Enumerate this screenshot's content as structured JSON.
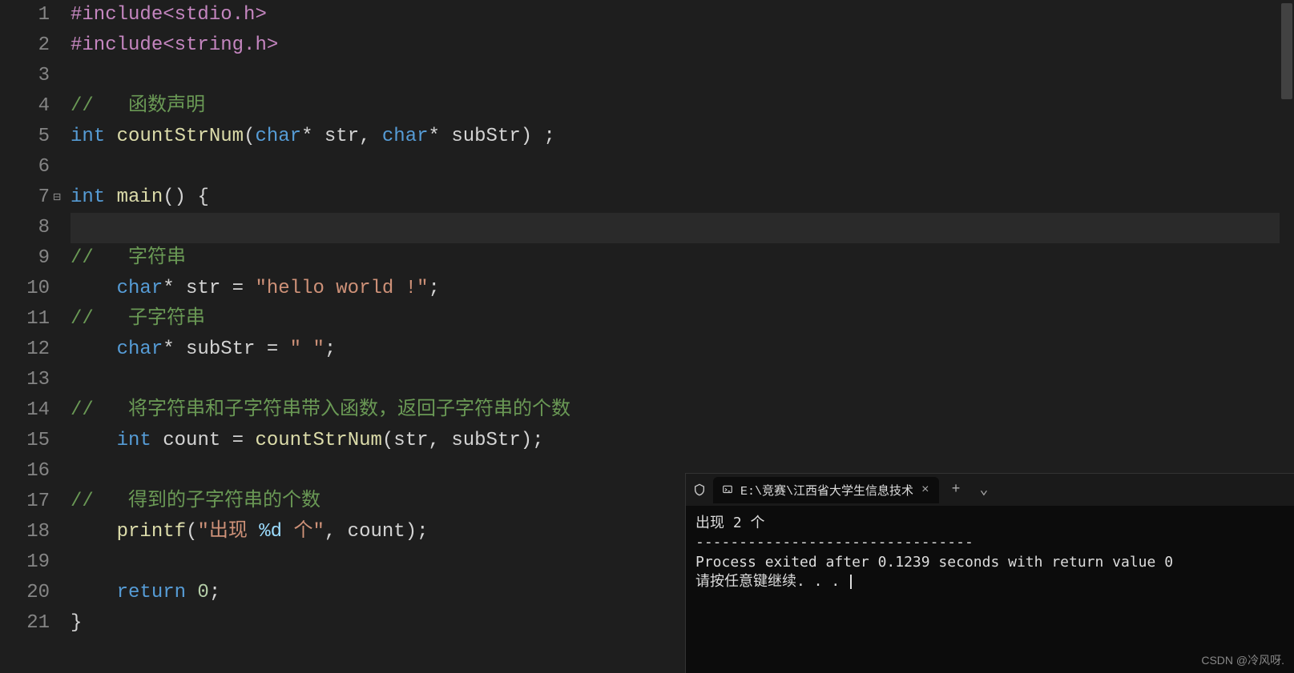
{
  "gutter": {
    "lines": [
      "1",
      "2",
      "3",
      "4",
      "5",
      "6",
      "7",
      "8",
      "9",
      "10",
      "11",
      "12",
      "13",
      "14",
      "15",
      "16",
      "17",
      "18",
      "19",
      "20",
      "21"
    ],
    "fold_line": 7
  },
  "code": {
    "l1_pre": "#include",
    "l1_path": "<stdio.h>",
    "l2_pre": "#include",
    "l2_path": "<string.h>",
    "l4_comment": "//   函数声明",
    "l5_type": "int",
    "l5_func": "countStrNum",
    "l5_p1_type": "char",
    "l5_p1_star": "*",
    "l5_p1_name": " str",
    "l5_comma": ", ",
    "l5_p2_type": "char",
    "l5_p2_star": "*",
    "l5_p2_name": " subStr",
    "l5_end": ") ;",
    "l7_type": "int",
    "l7_func": "main",
    "l7_rest": "() {",
    "l9_comment": "//   字符串",
    "l10_type": "char",
    "l10_star": "*",
    "l10_name": " str ",
    "l10_eq": "= ",
    "l10_str": "\"hello world !\"",
    "l10_semi": ";",
    "l11_comment": "//   子字符串",
    "l12_type": "char",
    "l12_star": "*",
    "l12_name": " subStr ",
    "l12_eq": "= ",
    "l12_str": "\" \"",
    "l12_semi": ";",
    "l14_comment": "//   将字符串和子字符串带入函数，返回子字符串的个数",
    "l15_type": "int",
    "l15_name": " count ",
    "l15_eq": "= ",
    "l15_func": "countStrNum",
    "l15_args": "(str, subStr);",
    "l17_comment": "//   得到的子字符串的个数",
    "l18_func": "printf",
    "l18_open": "(",
    "l18_str1": "\"出现 ",
    "l18_fmt": "%d",
    "l18_str2": " 个\"",
    "l18_rest": ", count);",
    "l20_kw": "return",
    "l20_num": " 0",
    "l20_semi": ";",
    "l21_brace": "}"
  },
  "terminal": {
    "tab_title": "E:\\竞赛\\江西省大学生信息技术",
    "out_line1": "出现 2 个",
    "out_sep": "--------------------------------",
    "out_line2": "Process exited after 0.1239 seconds with return value 0",
    "out_line3": "请按任意键继续. . . "
  },
  "watermark": "CSDN @冷风呀."
}
